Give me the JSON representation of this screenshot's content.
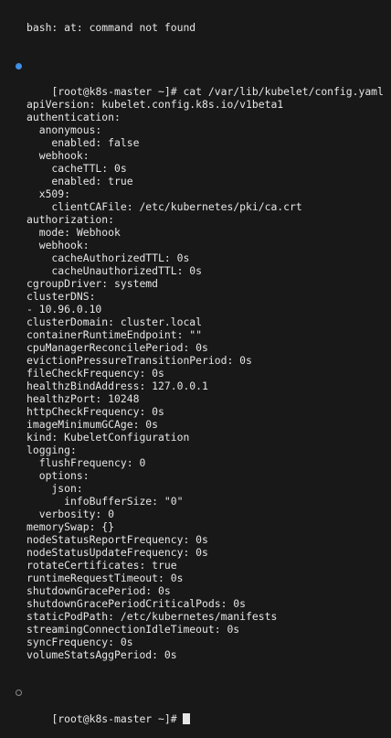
{
  "colors": {
    "background": "#181818",
    "text": "#e6e6e6",
    "command_marker": "#3f91e6",
    "prompt_marker": "#8a8a8a"
  },
  "terminal": {
    "previous_output": "bash: at: command not found",
    "command_line": "[root@k8s-master ~]# cat /var/lib/kubelet/config.yaml",
    "output_lines": [
      "apiVersion: kubelet.config.k8s.io/v1beta1",
      "authentication:",
      "  anonymous:",
      "    enabled: false",
      "  webhook:",
      "    cacheTTL: 0s",
      "    enabled: true",
      "  x509:",
      "    clientCAFile: /etc/kubernetes/pki/ca.crt",
      "authorization:",
      "  mode: Webhook",
      "  webhook:",
      "    cacheAuthorizedTTL: 0s",
      "    cacheUnauthorizedTTL: 0s",
      "cgroupDriver: systemd",
      "clusterDNS:",
      "- 10.96.0.10",
      "clusterDomain: cluster.local",
      "containerRuntimeEndpoint: \"\"",
      "cpuManagerReconcilePeriod: 0s",
      "evictionPressureTransitionPeriod: 0s",
      "fileCheckFrequency: 0s",
      "healthzBindAddress: 127.0.0.1",
      "healthzPort: 10248",
      "httpCheckFrequency: 0s",
      "imageMinimumGCAge: 0s",
      "kind: KubeletConfiguration",
      "logging:",
      "  flushFrequency: 0",
      "  options:",
      "    json:",
      "      infoBufferSize: \"0\"",
      "  verbosity: 0",
      "memorySwap: {}",
      "nodeStatusReportFrequency: 0s",
      "nodeStatusUpdateFrequency: 0s",
      "rotateCertificates: true",
      "runtimeRequestTimeout: 0s",
      "shutdownGracePeriod: 0s",
      "shutdownGracePeriodCriticalPods: 0s",
      "staticPodPath: /etc/kubernetes/manifests",
      "streamingConnectionIdleTimeout: 0s",
      "syncFrequency: 0s",
      "volumeStatsAggPeriod: 0s"
    ],
    "prompt": "[root@k8s-master ~]# "
  }
}
